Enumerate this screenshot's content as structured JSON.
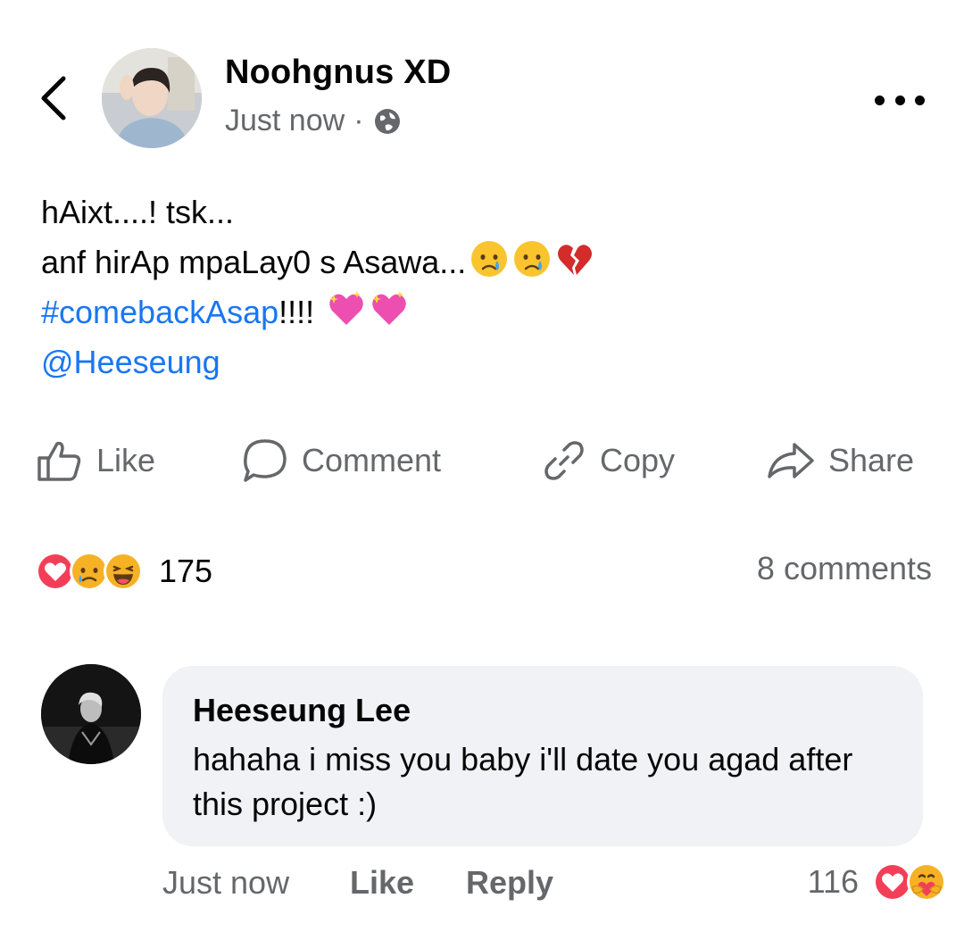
{
  "post": {
    "author": "Noohgnus XD",
    "timestamp": "Just now",
    "separator": "·",
    "privacy_icon": "globe-icon",
    "lines": {
      "l1": "hAixt....! tsk...",
      "l2": "anf hirAp mpaLay0 s Asawa...",
      "hashtag": "#comebackAsap",
      "l3_suffix": "!!!!",
      "mention": "@Heeseung"
    },
    "emojis": [
      "crying-face",
      "crying-face",
      "broken-heart",
      "sparkling-heart",
      "sparkling-heart"
    ]
  },
  "actions": {
    "like": "Like",
    "comment": "Comment",
    "copy": "Copy",
    "share": "Share"
  },
  "reactions": {
    "types": [
      "love",
      "sad",
      "haha"
    ],
    "count": "175",
    "comments": "8 comments"
  },
  "comment": {
    "author": "Heeseung Lee",
    "text": "hahaha i miss you baby i'll date you agad after this project :)",
    "time": "Just now",
    "like": "Like",
    "reply": "Reply",
    "reaction_count": "116",
    "reaction_types": [
      "love",
      "care"
    ]
  },
  "colors": {
    "link": "#1877f2",
    "secondary_text": "#65676b",
    "bubble_bg": "#f0f2f5",
    "love_red": "#f33e58"
  }
}
